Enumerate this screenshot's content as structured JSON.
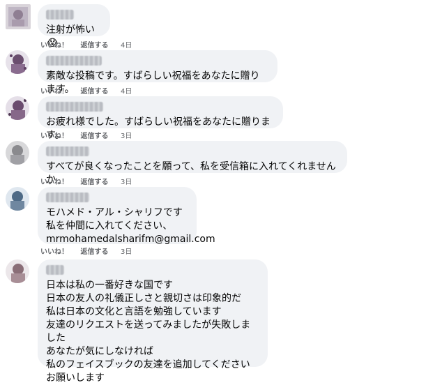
{
  "comments": [
    {
      "text": "注射が怖い",
      "emoji": "😱",
      "actions": {
        "like": "いいね！",
        "reply": "返信する",
        "time": "4日"
      }
    },
    {
      "text": "素敵な投稿です。すばらしい祝福をあなたに贈ります。",
      "actions": {
        "like": "いいね！",
        "reply": "返信する",
        "time": "4日"
      }
    },
    {
      "text": "お疲れ様でした。すばらしい祝福をあなたに贈ります。",
      "actions": {
        "like": "いいね！",
        "reply": "返信する",
        "time": "3日"
      }
    },
    {
      "text": "すべてが良くなったことを願って、私を受信箱に入れてくれませんか",
      "actions": {
        "like": "いいね！",
        "reply": "返信する",
        "time": "3日"
      }
    },
    {
      "text": "モハメド・アル・シャリフです\n私を仲間に入れてください、\nmrmohamedalsharifm@gmail.com",
      "actions": {
        "like": "いいね！",
        "reply": "返信する",
        "time": "3日"
      }
    },
    {
      "text": "日本は私の一番好きな国です\n日本の友人の礼儀正しさと親切さは印象的だ\n私は日本の文化と言語を勉強しています\n友達のリクエストを送ってみましたが失敗しました\nあなたが気にしなければ\n私のフェイスブックの友達を追加してください\nお願いします"
    }
  ],
  "colors": {
    "bubble": "#f0f2f5",
    "text": "#050505",
    "meta": "#65676b"
  }
}
